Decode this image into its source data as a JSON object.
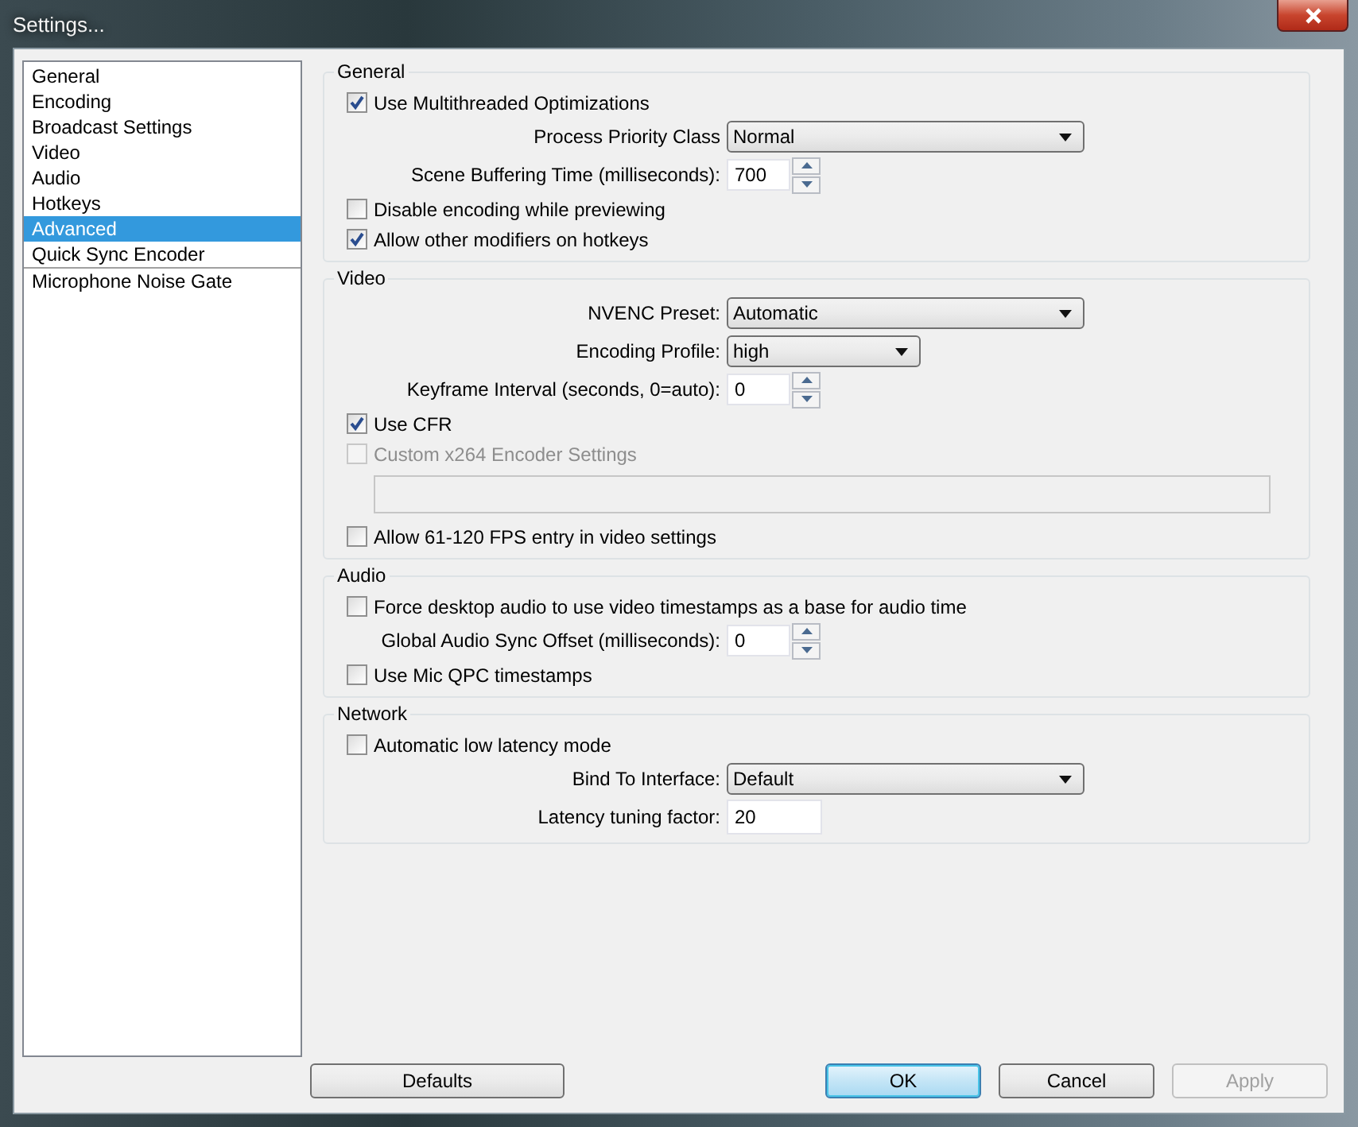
{
  "window": {
    "title": "Settings..."
  },
  "sidebar": {
    "items": [
      {
        "label": "General",
        "selected": false
      },
      {
        "label": "Encoding",
        "selected": false
      },
      {
        "label": "Broadcast Settings",
        "selected": false
      },
      {
        "label": "Video",
        "selected": false
      },
      {
        "label": "Audio",
        "selected": false
      },
      {
        "label": "Hotkeys",
        "selected": false
      },
      {
        "label": "Advanced",
        "selected": true
      },
      {
        "label": "Quick Sync Encoder",
        "selected": false
      },
      {
        "label": "Microphone Noise Gate",
        "selected": false
      }
    ]
  },
  "sections": [
    {
      "title": "General",
      "rows": [
        {
          "kind": "checkbox",
          "label": "Use Multithreaded Optimizations",
          "checked": true,
          "disabled": false
        },
        {
          "kind": "select",
          "label": "Process Priority Class",
          "value": "Normal"
        },
        {
          "kind": "spinner",
          "label": "Scene Buffering Time (milliseconds):",
          "value": "700"
        },
        {
          "kind": "checkbox",
          "label": "Disable encoding while previewing",
          "checked": false,
          "disabled": false
        },
        {
          "kind": "checkbox",
          "label": "Allow other modifiers on hotkeys",
          "checked": true,
          "disabled": false
        }
      ]
    },
    {
      "title": "Video",
      "rows": [
        {
          "kind": "select",
          "label": "NVENC Preset:",
          "value": "Automatic"
        },
        {
          "kind": "select",
          "label": "Encoding Profile:",
          "value": "high"
        },
        {
          "kind": "spinner",
          "label": "Keyframe Interval (seconds, 0=auto):",
          "value": "0"
        },
        {
          "kind": "checkbox",
          "label": "Use CFR",
          "checked": true,
          "disabled": false
        },
        {
          "kind": "checkbox",
          "label": "Custom x264 Encoder Settings",
          "checked": false,
          "disabled": true
        },
        {
          "kind": "textbox",
          "disabled": true
        },
        {
          "kind": "checkbox",
          "label": "Allow 61-120 FPS entry in video settings",
          "checked": false,
          "disabled": false
        }
      ]
    },
    {
      "title": "Audio",
      "rows": [
        {
          "kind": "checkbox",
          "label": "Force desktop audio to use video timestamps as a base for audio time",
          "checked": false,
          "disabled": false
        },
        {
          "kind": "spinner",
          "label": "Global Audio Sync Offset (milliseconds):",
          "value": "0"
        },
        {
          "kind": "checkbox",
          "label": "Use Mic QPC timestamps",
          "checked": false,
          "disabled": false
        }
      ]
    },
    {
      "title": "Network",
      "rows": [
        {
          "kind": "checkbox",
          "label": "Automatic low latency mode",
          "checked": false,
          "disabled": false
        },
        {
          "kind": "select",
          "label": "Bind To Interface:",
          "value": "Default"
        },
        {
          "kind": "input",
          "label": "Latency tuning factor:",
          "value": "20"
        }
      ]
    }
  ],
  "footer": {
    "left_buttons": [
      {
        "label": "Defaults",
        "focused": false,
        "disabled": false
      }
    ],
    "right_buttons": [
      {
        "label": "OK",
        "focused": true,
        "disabled": false
      },
      {
        "label": "Cancel",
        "focused": false,
        "disabled": false
      },
      {
        "label": "Apply",
        "focused": false,
        "disabled": true
      }
    ]
  }
}
